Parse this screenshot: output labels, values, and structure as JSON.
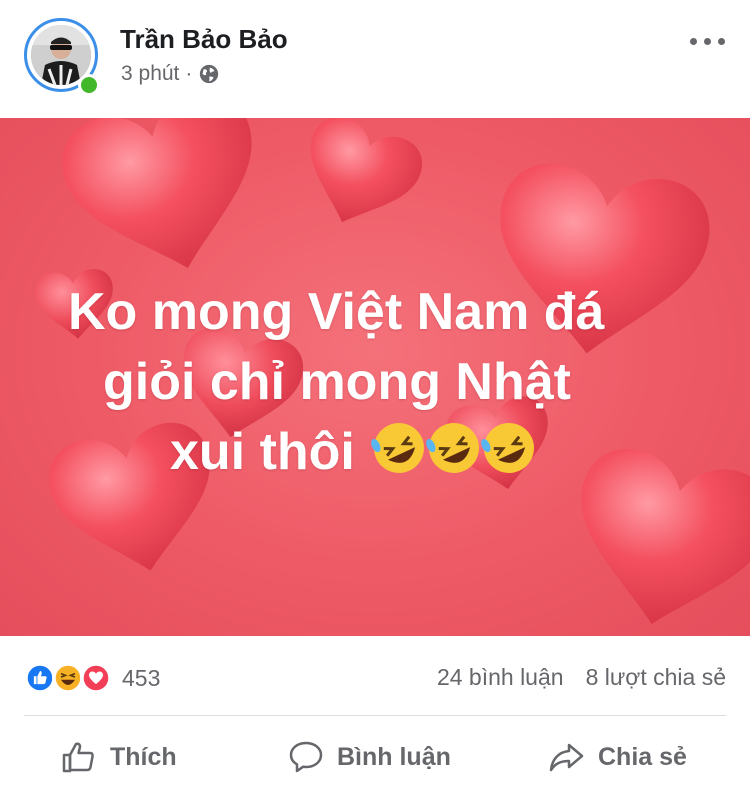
{
  "post": {
    "author_name": "Trần Bảo Bảo",
    "timestamp": "3 phút",
    "separator": "·",
    "privacy_icon": "globe-icon",
    "text_lines": [
      "Ko mong Việt Nam đá",
      "giỏi chỉ mong Nhật",
      "xui thôi"
    ],
    "emoji_icons": [
      "rofl-emoji",
      "rofl-emoji",
      "rofl-emoji"
    ],
    "background_color": "#ee5a66"
  },
  "engagement": {
    "reaction_icons": [
      "like-reaction-icon",
      "haha-reaction-icon",
      "love-reaction-icon"
    ],
    "reaction_count": "453",
    "comments": "24 bình luận",
    "shares": "8 lượt chia sẻ"
  },
  "actions": {
    "like_label": "Thích",
    "comment_label": "Bình luận",
    "share_label": "Chia sẻ"
  },
  "colors": {
    "accent": "#3b8fe8",
    "online": "#42b72a",
    "muted_text": "#65676b",
    "like_blue": "#1877f2",
    "love_red": "#f33e58",
    "haha_yellow": "#f7b125"
  }
}
